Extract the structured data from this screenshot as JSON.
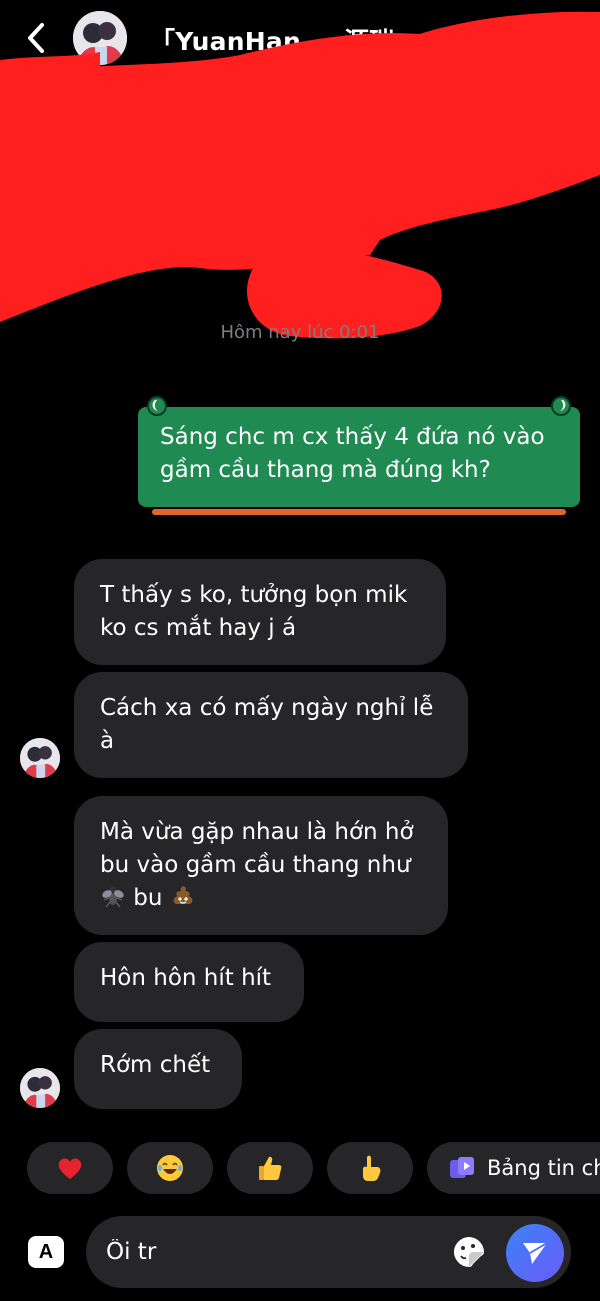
{
  "header": {
    "contact_name": "「YuanHan 　 源瑞 ."
  },
  "timestamp": "Hôm nay lúc 0:01",
  "messages": {
    "sent": "Sáng chc m cx thấy 4 đứa nó vào gầm cầu thang mà đúng kh?",
    "received": [
      {
        "text": "T thấy s ko, tưởng bọn mik ko cs mắt hay j á"
      },
      {
        "text": "Cách xa có mấy ngày nghỉ lễ à"
      },
      {
        "text_a": "Mà vừa gặp nhau là hớn hở bu vào gầm cầu thang như ",
        "text_b": " bu "
      },
      {
        "text": "Hôn hôn hít hít"
      },
      {
        "text": "Rớm chết"
      }
    ]
  },
  "quick_reactions": [
    {
      "icon": "heart-emoji-icon"
    },
    {
      "icon": "laughing-emoji-icon"
    },
    {
      "icon": "thumbs-up-emoji-icon"
    },
    {
      "icon": "pointing-hand-emoji-icon"
    },
    {
      "icon": "story-icon",
      "label": "Bảng tin ch"
    }
  ],
  "composer": {
    "value": "Ôi tr",
    "aa_label": "A"
  },
  "colors": {
    "sent_bubble": "#1f8a52",
    "received_bubble": "#262628",
    "redaction": "#ff1f1f",
    "send_button": "#4a6cf7"
  }
}
